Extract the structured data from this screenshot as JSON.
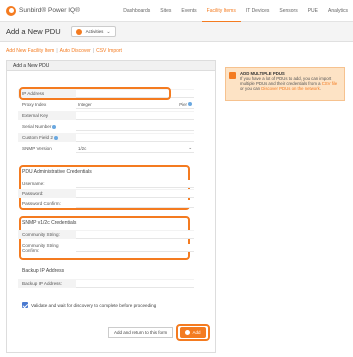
{
  "app": {
    "name": "Sunbird® Power IQ®"
  },
  "nav": {
    "items": [
      {
        "label": "Dashboards"
      },
      {
        "label": "Sites"
      },
      {
        "label": "Events"
      },
      {
        "label": "Facility Items"
      },
      {
        "label": "IT Devices"
      },
      {
        "label": "Sensors"
      },
      {
        "label": "PUE"
      },
      {
        "label": "Analytics"
      }
    ],
    "active": "Facility Items"
  },
  "title_bar": {
    "title": "Add a New PDU",
    "activities_label": "Activities"
  },
  "subtabs": {
    "add_new": "Add New Facility Item",
    "auto_discover": "Auto Discover",
    "csv_import": "CSV Import",
    "separator": "|"
  },
  "form": {
    "header": "Add a New PDU",
    "fields": {
      "ip_address": {
        "label": "IP Address",
        "value": ""
      },
      "proxy_index": {
        "label": "Proxy Index",
        "value": "Integer",
        "extra": "Pier"
      },
      "external_key": {
        "label": "External Key",
        "value": ""
      },
      "serial_number": {
        "label": "Serial Number",
        "value": ""
      },
      "custom_field_2": {
        "label": "Custom Field 2",
        "value": ""
      },
      "snmp_version": {
        "label": "SNMP Version",
        "value": "1/2c"
      }
    },
    "admin_section": {
      "title": "PDU Administrative Credentials",
      "username": "Username:",
      "password": "Password:",
      "password_confirm": "Password Confirm:"
    },
    "snmp_section": {
      "title": "SNMP v1/2c Credentials",
      "community": "Community String:",
      "community_confirm_1": "Community String",
      "community_confirm_2": "Confirm:"
    },
    "backup_section": {
      "title": "Backup IP Address",
      "label": "Backup IP Address:"
    },
    "validate_checkbox": {
      "label": "Validate and wait for discovery to complete before proceeding",
      "checked": true
    },
    "buttons": {
      "add_and_return": "Add and return to this form",
      "add": "Add"
    }
  },
  "info": {
    "title": "ADD MULTIPLE PDUS",
    "text_1": "If you have a lot of PDUs to add, you can import multiple PDUs and their credentials from a ",
    "link_csv": "CSV file",
    "text_2": " or you can ",
    "link_discover": "Discover PDUs on the network",
    "text_3": "."
  },
  "colors": {
    "accent": "#f47b20",
    "info_bg": "#fde3c5"
  }
}
